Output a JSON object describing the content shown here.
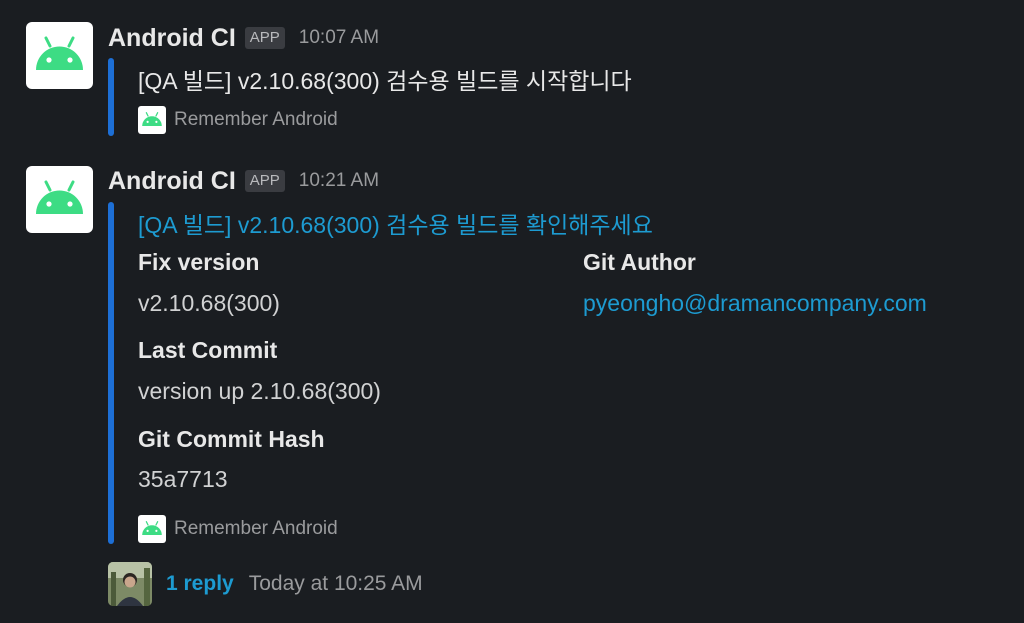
{
  "messages": [
    {
      "sender": "Android CI",
      "badge": "APP",
      "time": "10:07 AM",
      "text": "[QA 빌드] v2.10.68(300) 검수용 빌드를 시작합니다",
      "footer": "Remember Android"
    },
    {
      "sender": "Android CI",
      "badge": "APP",
      "time": "10:21 AM",
      "title": "[QA 빌드] v2.10.68(300) 검수용 빌드를 확인해주세요",
      "fields": {
        "fix_version_label": "Fix version",
        "fix_version_value": "v2.10.68(300)",
        "git_author_label": "Git Author",
        "git_author_value": "pyeongho@dramancompany.com",
        "last_commit_label": "Last Commit",
        "last_commit_value": "version up 2.10.68(300)",
        "commit_hash_label": "Git Commit Hash",
        "commit_hash_value": "35a7713"
      },
      "footer": "Remember Android"
    }
  ],
  "thread": {
    "reply_count": "1 reply",
    "last_reply": "Today at 10:25 AM"
  },
  "colors": {
    "background": "#1a1d21",
    "attachment_bar": "#1d6fd6",
    "link": "#1d9bd1",
    "android_green": "#3ddc84"
  },
  "icons": {
    "avatar": "android-robot-icon",
    "footer": "android-robot-icon"
  }
}
